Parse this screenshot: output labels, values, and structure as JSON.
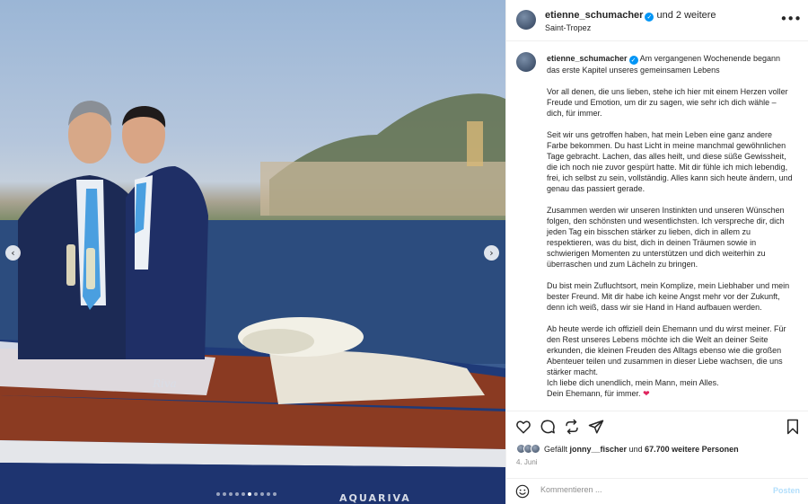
{
  "post": {
    "author": "etienne_schumacher",
    "coauthors": "und 2 weitere",
    "location": "Saint-Tropez"
  },
  "caption": {
    "username": "etienne_schumacher",
    "intro": "Am vergangenen Wochenende begann das erste Kapitel unseres gemeinsamen Lebens",
    "p1": "Vor all denen, die uns lieben, stehe ich hier mit einem Herzen voller Freude und Emotion, um dir zu sagen, wie sehr ich dich wähle – dich, für immer.",
    "p2": "Seit wir uns getroffen haben, hat mein Leben eine ganz andere Farbe bekommen. Du hast Licht in meine manchmal gewöhnlichen Tage gebracht. Lachen, das alles heilt, und diese süße Gewissheit, die ich noch nie zuvor gespürt hatte. Mit dir fühle ich mich lebendig, frei, ich selbst zu sein, vollständig. Alles kann sich heute ändern, und genau das passiert gerade.",
    "p3": "Zusammen werden wir unseren Instinkten und unseren Wünschen folgen, den schönsten und wesentlichsten. Ich verspreche dir, dich jeden Tag ein bisschen stärker zu lieben, dich in allem zu respektieren, was du bist, dich in deinen Träumen sowie in schwierigen Momenten zu unterstützen und dich weiterhin zu überraschen und zum Lächeln zu bringen.",
    "p4": "Du bist mein Zufluchtsort, mein Komplize, mein Liebhaber und mein bester Freund. Mit dir habe ich keine Angst mehr vor der Zukunft, denn ich weiß, dass wir sie Hand in Hand aufbauen werden.",
    "p5a": "Ab heute werde ich offiziell dein Ehemann und du wirst meiner. Für den Rest unseres Lebens möchte ich die Welt an deiner Seite erkunden, die kleinen Freuden des Alltags ebenso wie die großen Abenteuer teilen und zusammen in dieser Liebe wachsen, die uns stärker macht.",
    "p5b": "Ich liebe dich unendlich, mein Mann, mein Alles.",
    "p5c": "Dein Ehemann, für immer.",
    "heart": "❤"
  },
  "likes": {
    "prefix": "Gefällt",
    "user": "jonny__fischer",
    "middle": "und",
    "count": "67.700 weitere Personen"
  },
  "date": "4. Juni",
  "comment": {
    "placeholder": "Kommentieren ...",
    "post_label": "Posten"
  },
  "media": {
    "boat_brand": "Riva",
    "boat_model": "AQUARIVA",
    "carousel_count": 10,
    "carousel_active": 5
  },
  "icons": {
    "more": "more-options-icon",
    "like": "heart-icon",
    "comment": "comment-icon",
    "share": "share-icon",
    "send": "send-icon",
    "save": "bookmark-icon",
    "emoji": "emoji-icon",
    "prev": "chevron-left-icon",
    "next": "chevron-right-icon"
  },
  "colors": {
    "accent": "#0095f6",
    "post_disabled": "#b2dffc",
    "heart": "#e0245e"
  }
}
